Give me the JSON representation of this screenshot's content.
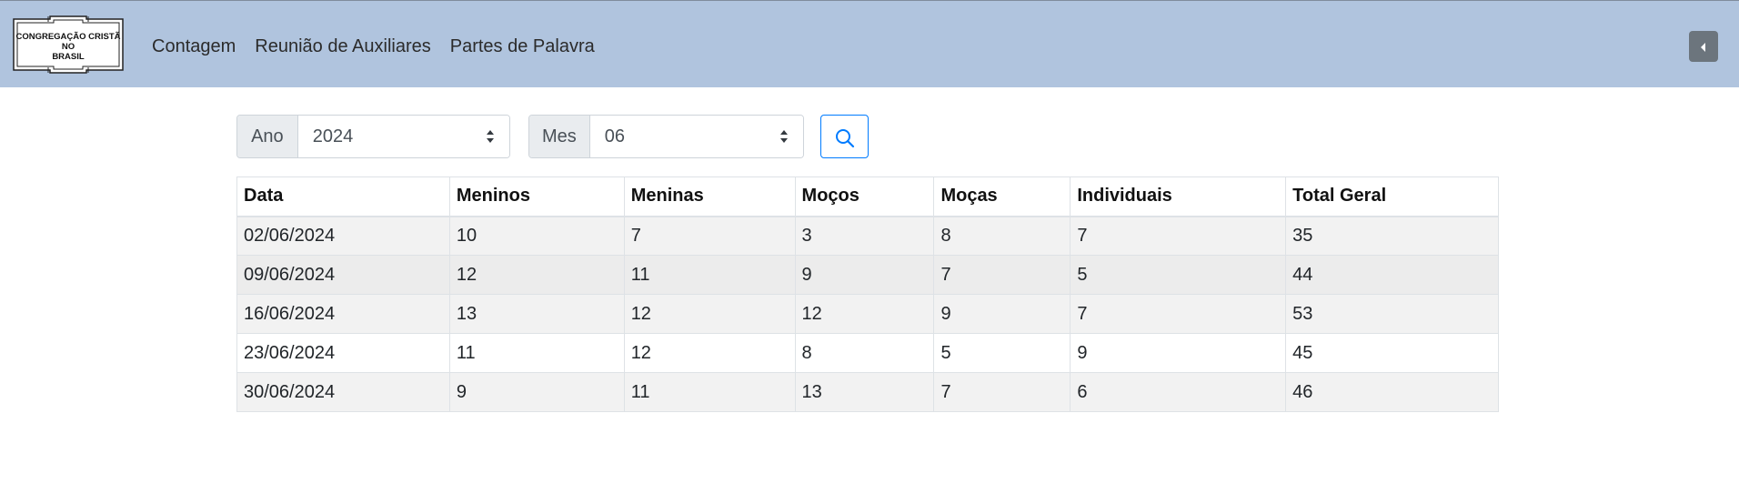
{
  "header": {
    "logo_text": [
      "CONGREGAÇÃO CRISTÃ",
      "NO",
      "BRASIL"
    ],
    "nav": [
      "Contagem",
      "Reunião de Auxiliares",
      "Partes de Palavra"
    ],
    "toggle_icon": "caret-left-icon",
    "colors": {
      "background": "#b0c4de",
      "toggle": "#6c757d"
    }
  },
  "filters": {
    "year_label": "Ano",
    "year_value": "2024",
    "month_label": "Mes",
    "month_value": "06",
    "search_icon": "search-icon",
    "accent": "#007bff"
  },
  "table": {
    "columns": [
      "Data",
      "Meninos",
      "Meninas",
      "Moços",
      "Moças",
      "Individuais",
      "Total Geral"
    ],
    "rows": [
      [
        "02/06/2024",
        "10",
        "7",
        "3",
        "8",
        "7",
        "35"
      ],
      [
        "09/06/2024",
        "12",
        "11",
        "9",
        "7",
        "5",
        "44"
      ],
      [
        "16/06/2024",
        "13",
        "12",
        "12",
        "9",
        "7",
        "53"
      ],
      [
        "23/06/2024",
        "11",
        "12",
        "8",
        "5",
        "9",
        "45"
      ],
      [
        "30/06/2024",
        "9",
        "11",
        "13",
        "7",
        "6",
        "46"
      ]
    ]
  }
}
